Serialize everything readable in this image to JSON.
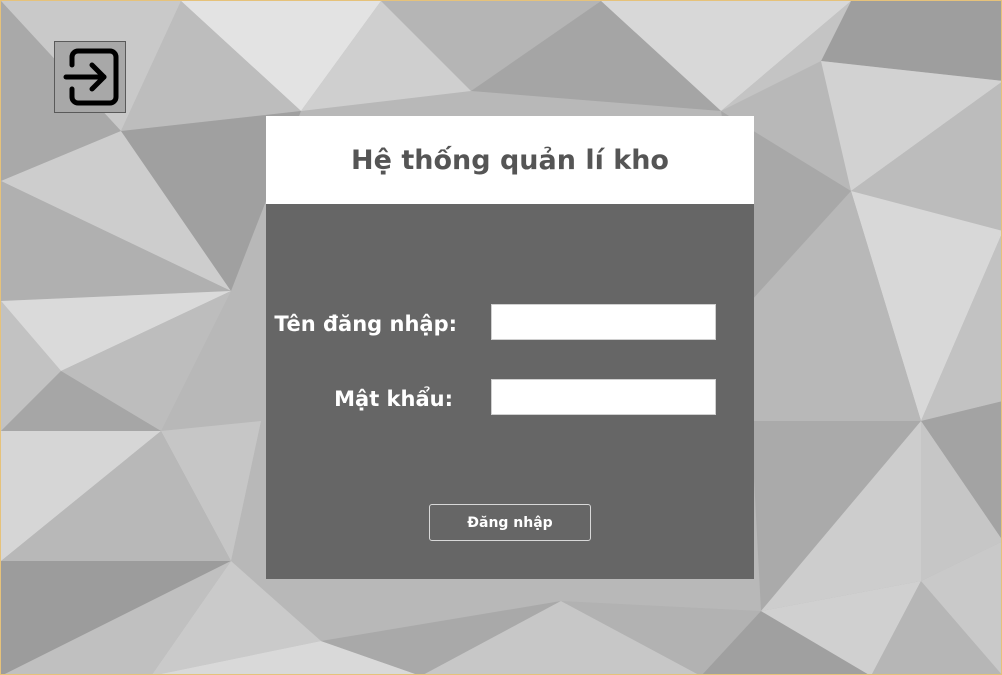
{
  "window": {
    "accent_border": "#e6c27a",
    "background_style": "gray low-poly triangles"
  },
  "exit_button": {
    "icon": "exit-arrow-icon"
  },
  "login_panel": {
    "title": "Hệ thống quản lí kho",
    "header_color": "#ffffff",
    "body_color": "#666666",
    "username": {
      "label": "Tên đăng nhập:",
      "value": "",
      "placeholder": ""
    },
    "password": {
      "label": "Mật khẩu:",
      "value": "",
      "placeholder": ""
    },
    "login_button_label": "Đăng nhập"
  }
}
